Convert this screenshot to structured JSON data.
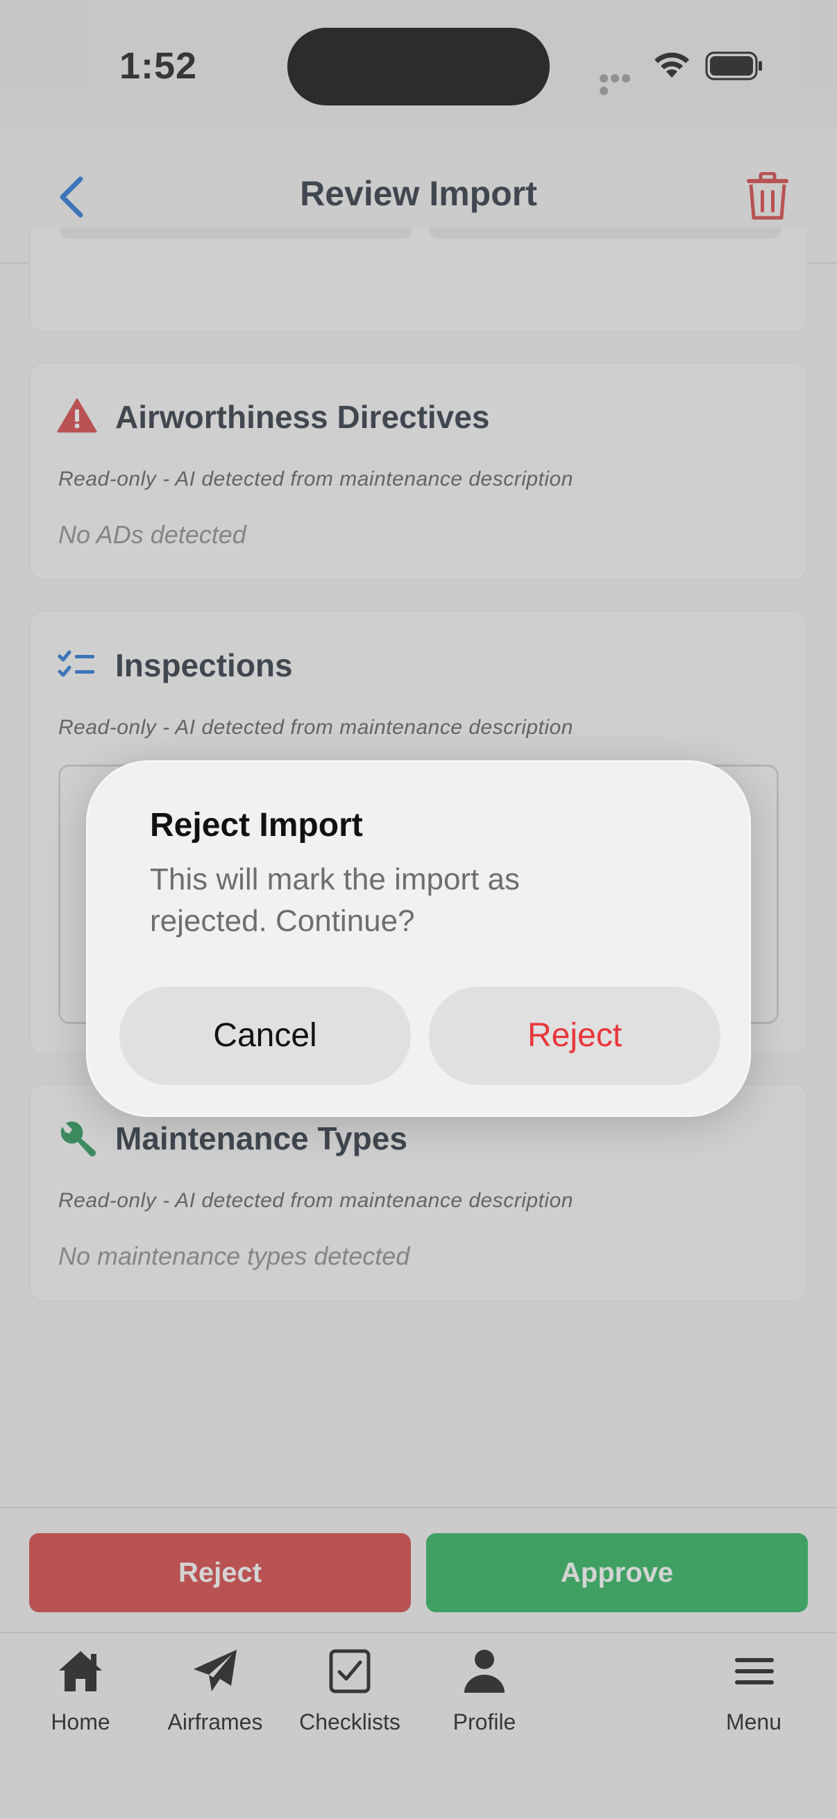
{
  "status_bar": {
    "time": "1:52"
  },
  "nav": {
    "title": "Review Import"
  },
  "sections": {
    "ads": {
      "title": "Airworthiness Directives",
      "note": "Read-only - AI detected from maintenance description",
      "empty": "No ADs detected"
    },
    "inspections": {
      "title": "Inspections",
      "note": "Read-only - AI detected from maintenance description"
    },
    "maintenance_types": {
      "title": "Maintenance Types",
      "note": "Read-only - AI detected from maintenance description",
      "empty": "No maintenance types detected"
    }
  },
  "actions": {
    "reject": "Reject",
    "approve": "Approve"
  },
  "tabs": [
    {
      "label": "Home",
      "icon": "home-icon"
    },
    {
      "label": "Airframes",
      "icon": "paper-plane-icon"
    },
    {
      "label": "Checklists",
      "icon": "checkbox-icon"
    },
    {
      "label": "Profile",
      "icon": "person-icon"
    },
    {
      "label": "Menu",
      "icon": "hamburger-icon"
    }
  ],
  "dialog": {
    "title": "Reject Import",
    "message": "This will mark the import as rejected. Continue?",
    "cancel": "Cancel",
    "confirm": "Reject"
  },
  "colors": {
    "accent_blue": "#1a6fd6",
    "danger": "#d63a3a",
    "success": "#1fb155",
    "dialog_destructive": "#e8363a"
  }
}
